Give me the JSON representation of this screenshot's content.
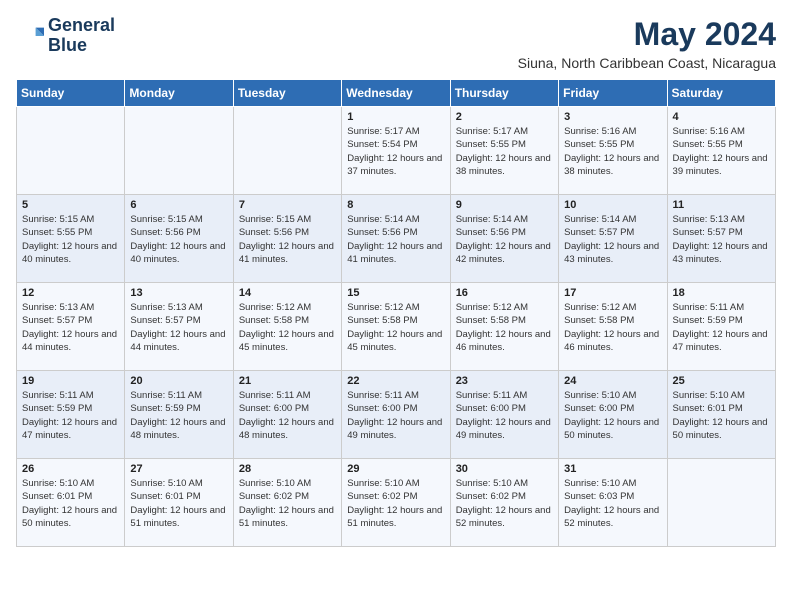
{
  "logo": {
    "line1": "General",
    "line2": "Blue"
  },
  "title": "May 2024",
  "location": "Siuna, North Caribbean Coast, Nicaragua",
  "days_of_week": [
    "Sunday",
    "Monday",
    "Tuesday",
    "Wednesday",
    "Thursday",
    "Friday",
    "Saturday"
  ],
  "weeks": [
    [
      {
        "day": "",
        "content": ""
      },
      {
        "day": "",
        "content": ""
      },
      {
        "day": "",
        "content": ""
      },
      {
        "day": "1",
        "content": "Sunrise: 5:17 AM\nSunset: 5:54 PM\nDaylight: 12 hours\nand 37 minutes."
      },
      {
        "day": "2",
        "content": "Sunrise: 5:17 AM\nSunset: 5:55 PM\nDaylight: 12 hours\nand 38 minutes."
      },
      {
        "day": "3",
        "content": "Sunrise: 5:16 AM\nSunset: 5:55 PM\nDaylight: 12 hours\nand 38 minutes."
      },
      {
        "day": "4",
        "content": "Sunrise: 5:16 AM\nSunset: 5:55 PM\nDaylight: 12 hours\nand 39 minutes."
      }
    ],
    [
      {
        "day": "5",
        "content": "Sunrise: 5:15 AM\nSunset: 5:55 PM\nDaylight: 12 hours\nand 40 minutes."
      },
      {
        "day": "6",
        "content": "Sunrise: 5:15 AM\nSunset: 5:56 PM\nDaylight: 12 hours\nand 40 minutes."
      },
      {
        "day": "7",
        "content": "Sunrise: 5:15 AM\nSunset: 5:56 PM\nDaylight: 12 hours\nand 41 minutes."
      },
      {
        "day": "8",
        "content": "Sunrise: 5:14 AM\nSunset: 5:56 PM\nDaylight: 12 hours\nand 41 minutes."
      },
      {
        "day": "9",
        "content": "Sunrise: 5:14 AM\nSunset: 5:56 PM\nDaylight: 12 hours\nand 42 minutes."
      },
      {
        "day": "10",
        "content": "Sunrise: 5:14 AM\nSunset: 5:57 PM\nDaylight: 12 hours\nand 43 minutes."
      },
      {
        "day": "11",
        "content": "Sunrise: 5:13 AM\nSunset: 5:57 PM\nDaylight: 12 hours\nand 43 minutes."
      }
    ],
    [
      {
        "day": "12",
        "content": "Sunrise: 5:13 AM\nSunset: 5:57 PM\nDaylight: 12 hours\nand 44 minutes."
      },
      {
        "day": "13",
        "content": "Sunrise: 5:13 AM\nSunset: 5:57 PM\nDaylight: 12 hours\nand 44 minutes."
      },
      {
        "day": "14",
        "content": "Sunrise: 5:12 AM\nSunset: 5:58 PM\nDaylight: 12 hours\nand 45 minutes."
      },
      {
        "day": "15",
        "content": "Sunrise: 5:12 AM\nSunset: 5:58 PM\nDaylight: 12 hours\nand 45 minutes."
      },
      {
        "day": "16",
        "content": "Sunrise: 5:12 AM\nSunset: 5:58 PM\nDaylight: 12 hours\nand 46 minutes."
      },
      {
        "day": "17",
        "content": "Sunrise: 5:12 AM\nSunset: 5:58 PM\nDaylight: 12 hours\nand 46 minutes."
      },
      {
        "day": "18",
        "content": "Sunrise: 5:11 AM\nSunset: 5:59 PM\nDaylight: 12 hours\nand 47 minutes."
      }
    ],
    [
      {
        "day": "19",
        "content": "Sunrise: 5:11 AM\nSunset: 5:59 PM\nDaylight: 12 hours\nand 47 minutes."
      },
      {
        "day": "20",
        "content": "Sunrise: 5:11 AM\nSunset: 5:59 PM\nDaylight: 12 hours\nand 48 minutes."
      },
      {
        "day": "21",
        "content": "Sunrise: 5:11 AM\nSunset: 6:00 PM\nDaylight: 12 hours\nand 48 minutes."
      },
      {
        "day": "22",
        "content": "Sunrise: 5:11 AM\nSunset: 6:00 PM\nDaylight: 12 hours\nand 49 minutes."
      },
      {
        "day": "23",
        "content": "Sunrise: 5:11 AM\nSunset: 6:00 PM\nDaylight: 12 hours\nand 49 minutes."
      },
      {
        "day": "24",
        "content": "Sunrise: 5:10 AM\nSunset: 6:00 PM\nDaylight: 12 hours\nand 50 minutes."
      },
      {
        "day": "25",
        "content": "Sunrise: 5:10 AM\nSunset: 6:01 PM\nDaylight: 12 hours\nand 50 minutes."
      }
    ],
    [
      {
        "day": "26",
        "content": "Sunrise: 5:10 AM\nSunset: 6:01 PM\nDaylight: 12 hours\nand 50 minutes."
      },
      {
        "day": "27",
        "content": "Sunrise: 5:10 AM\nSunset: 6:01 PM\nDaylight: 12 hours\nand 51 minutes."
      },
      {
        "day": "28",
        "content": "Sunrise: 5:10 AM\nSunset: 6:02 PM\nDaylight: 12 hours\nand 51 minutes."
      },
      {
        "day": "29",
        "content": "Sunrise: 5:10 AM\nSunset: 6:02 PM\nDaylight: 12 hours\nand 51 minutes."
      },
      {
        "day": "30",
        "content": "Sunrise: 5:10 AM\nSunset: 6:02 PM\nDaylight: 12 hours\nand 52 minutes."
      },
      {
        "day": "31",
        "content": "Sunrise: 5:10 AM\nSunset: 6:03 PM\nDaylight: 12 hours\nand 52 minutes."
      },
      {
        "day": "",
        "content": ""
      }
    ]
  ]
}
